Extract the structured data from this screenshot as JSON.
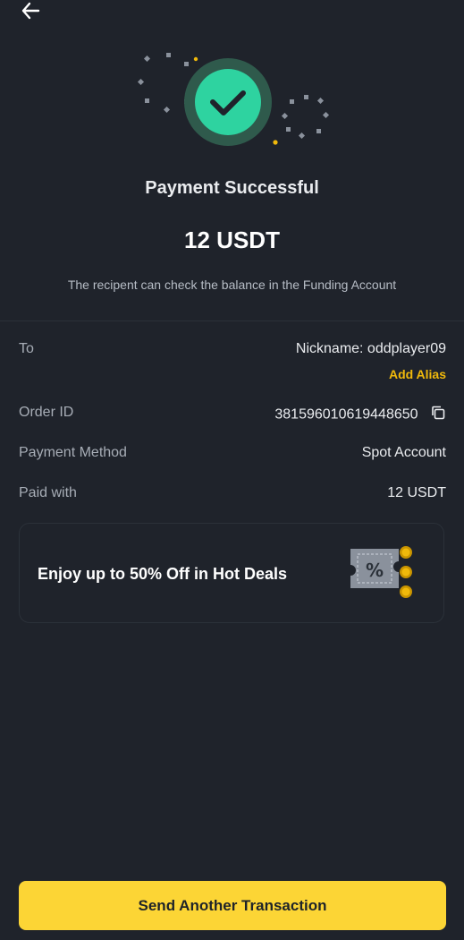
{
  "header": {
    "back_icon": "arrow-left-icon"
  },
  "status": {
    "icon": "check-circle-icon",
    "title": "Payment Successful",
    "amount": "12 USDT",
    "subtitle": "The recipent can check the balance in the Funding Account"
  },
  "details": {
    "to_label": "To",
    "to_value": "Nickname: oddplayer09",
    "add_alias": "Add Alias",
    "order_id_label": "Order ID",
    "order_id_value": "381596010619448650",
    "copy_icon": "copy-icon",
    "payment_method_label": "Payment Method",
    "payment_method_value": "Spot Account",
    "paid_with_label": "Paid with",
    "paid_with_value": "12 USDT"
  },
  "promo": {
    "text": "Enjoy up to 50% Off in Hot Deals",
    "art_icon": "discount-ticket-icon"
  },
  "footer": {
    "button_label": "Send Another Transaction"
  },
  "colors": {
    "background": "#1f232b",
    "accent": "#fcd535",
    "success": "#2ed3a0",
    "alias": "#f0b90b",
    "muted_text": "#a7adb6"
  }
}
